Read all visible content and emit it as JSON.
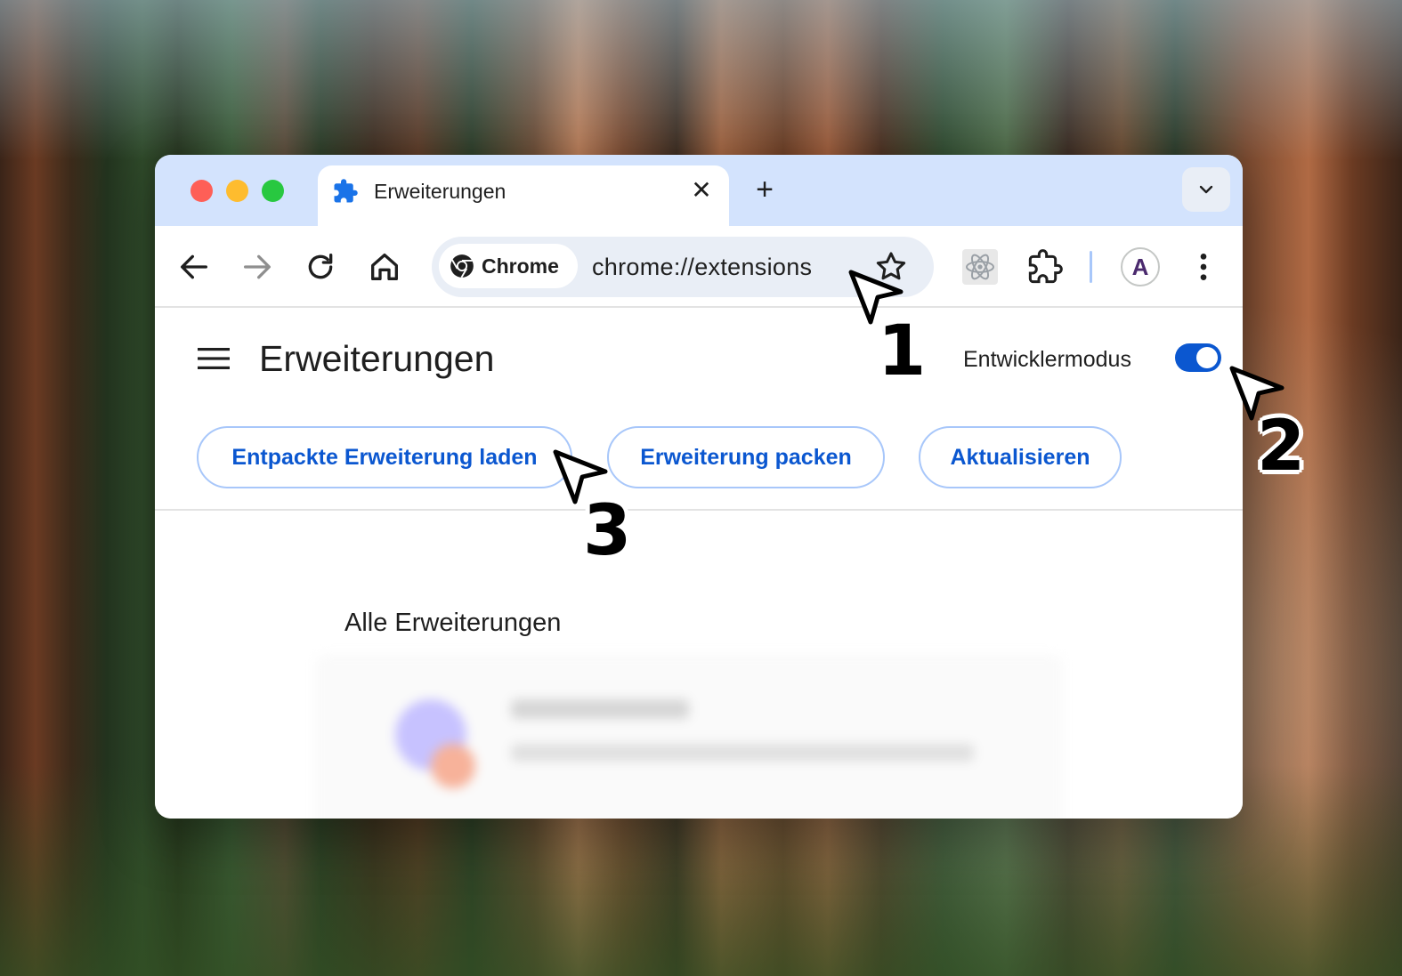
{
  "tab": {
    "title": "Erweiterungen",
    "close_glyph": "✕",
    "new_tab_glyph": "+"
  },
  "omnibox": {
    "chip_label": "Chrome",
    "url": "chrome://extensions"
  },
  "profile": {
    "initial": "A"
  },
  "page": {
    "title": "Erweiterungen",
    "developer_mode_label": "Entwicklermodus",
    "developer_mode_on": true,
    "actions": [
      {
        "label": "Entpackte Erweiterung laden"
      },
      {
        "label": "Erweiterung packen"
      },
      {
        "label": "Aktualisieren"
      }
    ],
    "section_title": "Alle Erweiterungen"
  },
  "callouts": [
    "1",
    "2",
    "3"
  ],
  "icons": [
    "puzzle-icon",
    "close-icon",
    "plus-icon",
    "chevron-down-icon",
    "back-arrow-icon",
    "forward-arrow-icon",
    "reload-icon",
    "home-icon",
    "chrome-logo-icon",
    "star-icon",
    "react-devtools-icon",
    "extensions-icon",
    "more-vert-icon",
    "menu-icon",
    "cursor-icon"
  ],
  "colors": {
    "accent": "#0b57d0",
    "tabstrip": "#d3e3fd",
    "button_border": "#a8c7fa"
  }
}
